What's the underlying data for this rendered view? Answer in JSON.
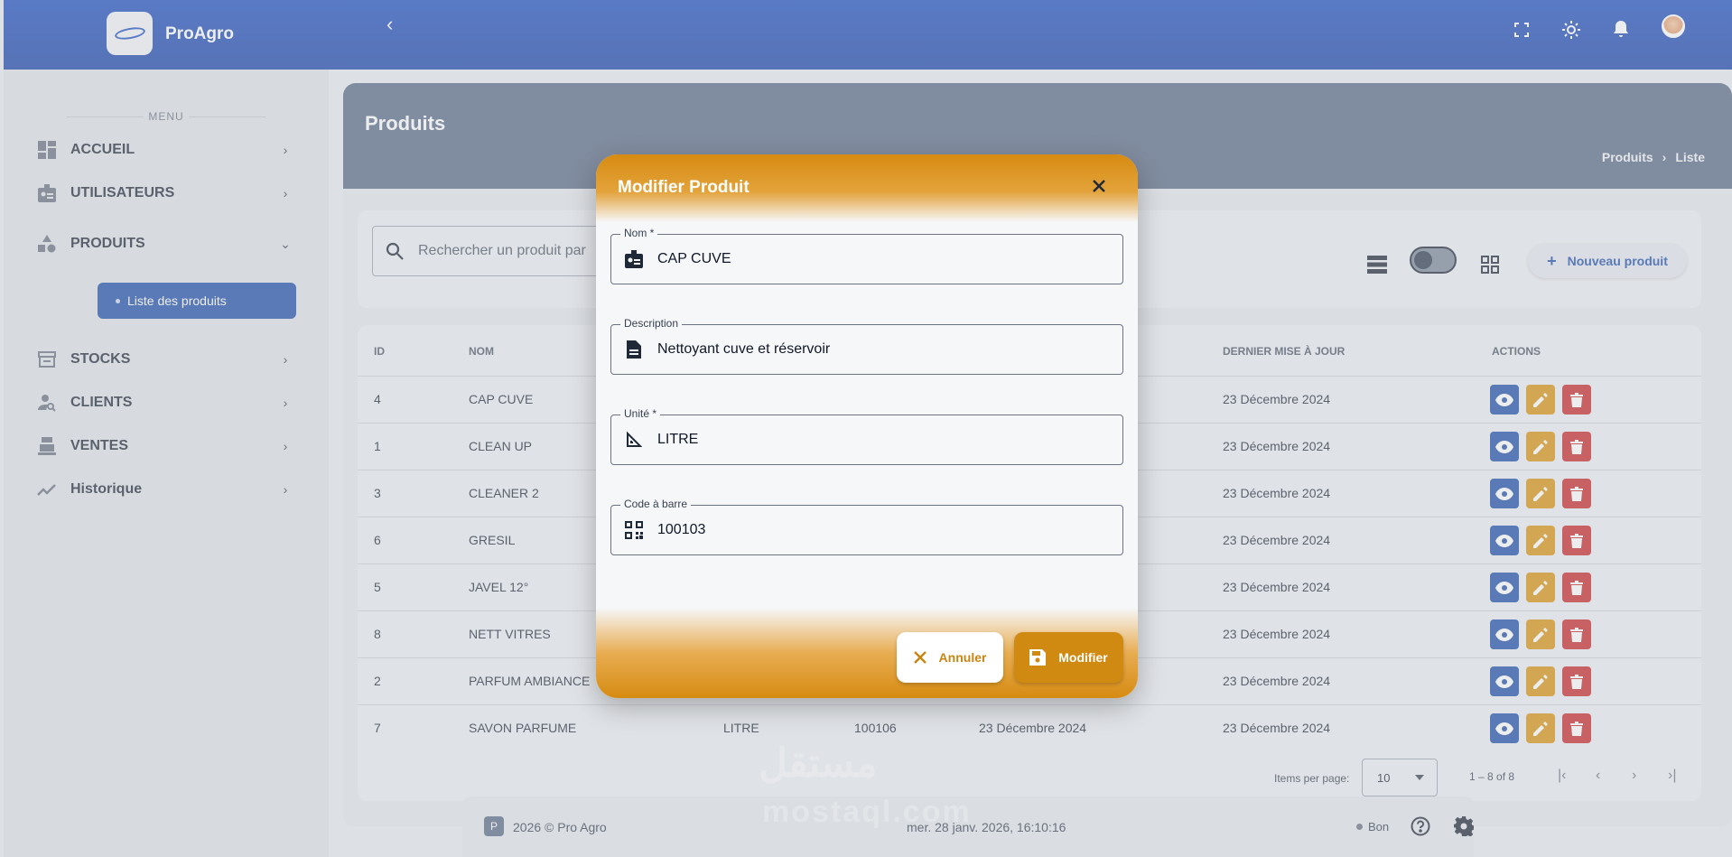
{
  "app": {
    "name": "ProAgro"
  },
  "sidebar": {
    "menu_label": "MENU",
    "items": [
      {
        "label": "ACCUEIL",
        "icon": "dashboard-icon"
      },
      {
        "label": "UTILISATEURS",
        "icon": "id-badge-icon"
      },
      {
        "label": "PRODUITS",
        "icon": "shapes-icon"
      },
      {
        "label": "STOCKS",
        "icon": "store-icon"
      },
      {
        "label": "CLIENTS",
        "icon": "user-search-icon"
      },
      {
        "label": "VENTES",
        "icon": "register-icon"
      },
      {
        "label": "Historique",
        "icon": "trend-icon"
      }
    ],
    "active_sub": "Liste des produits"
  },
  "page": {
    "title": "Produits",
    "breadcrumb": [
      "Produits",
      "Liste"
    ]
  },
  "search": {
    "placeholder": "Rechercher un produit par"
  },
  "toolbar": {
    "new_label": "Nouveau produit"
  },
  "table": {
    "headers": [
      "ID",
      "NOM",
      "DERNIER MISE À JOUR",
      "ACTIONS"
    ],
    "rows": [
      {
        "id": "4",
        "nom": "CAP CUVE",
        "unite": "",
        "code": "",
        "date": "",
        "maj": "23 Décembre 2024"
      },
      {
        "id": "1",
        "nom": "CLEAN UP",
        "unite": "",
        "code": "",
        "date": "",
        "maj": "23 Décembre 2024"
      },
      {
        "id": "3",
        "nom": "CLEANER 2",
        "unite": "",
        "code": "",
        "date": "",
        "maj": "23 Décembre 2024"
      },
      {
        "id": "6",
        "nom": "GRESIL",
        "unite": "",
        "code": "",
        "date": "",
        "maj": "23 Décembre 2024"
      },
      {
        "id": "5",
        "nom": "JAVEL 12°",
        "unite": "",
        "code": "",
        "date": "",
        "maj": "23 Décembre 2024"
      },
      {
        "id": "8",
        "nom": "NETT VITRES",
        "unite": "",
        "code": "",
        "date": "",
        "maj": "23 Décembre 2024"
      },
      {
        "id": "2",
        "nom": "PARFUM AMBIANCE",
        "unite": "",
        "code": "",
        "date": "",
        "maj": "23 Décembre 2024"
      },
      {
        "id": "7",
        "nom": "SAVON PARFUME",
        "unite": "LITRE",
        "code": "100106",
        "date": "23 Décembre 2024",
        "maj": "23 Décembre 2024"
      }
    ]
  },
  "pager": {
    "label": "Items per page:",
    "per_page": "10",
    "range": "1 – 8 of 8"
  },
  "footer": {
    "logo_letter": "P",
    "copyright": "2026 © Pro Agro",
    "datetime": "mer. 28 janv. 2026, 16:10:16",
    "status": "Bon"
  },
  "modal": {
    "title": "Modifier Produit",
    "fields": [
      {
        "label": "Nom *",
        "value": "CAP CUVE"
      },
      {
        "label": "Description",
        "value": "Nettoyant cuve et réservoir"
      },
      {
        "label": "Unité *",
        "value": "LITRE"
      },
      {
        "label": "Code à barre",
        "value": "100103"
      }
    ],
    "cancel_label": "Annuler",
    "modify_label": "Modifier"
  },
  "watermark": {
    "line1": "مستقل",
    "line2": "mostaql.com"
  },
  "colors": {
    "primary": "#1e4fa8",
    "accent": "#d08a12",
    "danger": "#c62828"
  }
}
